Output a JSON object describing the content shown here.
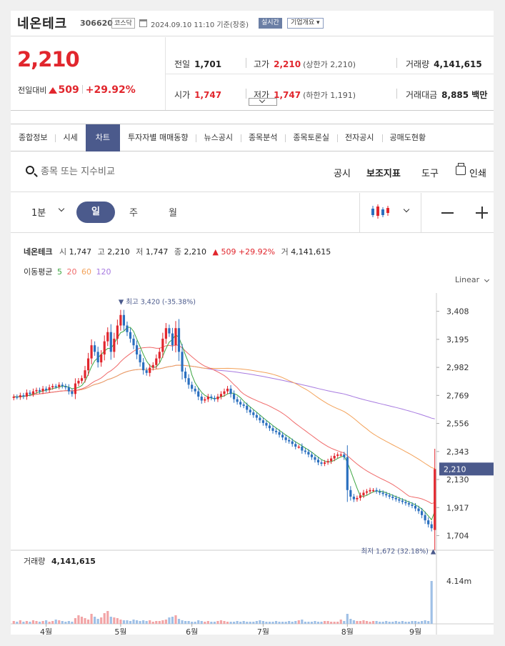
{
  "header": {
    "name": "네온테크",
    "code": "306620",
    "market": "코스닥",
    "datetime": "2024.09.10 11:10 기준(장중)",
    "realtime": "실시간",
    "company_btn": "기업개요 ▾"
  },
  "quote": {
    "price": "2,210",
    "change_label": "전일대비",
    "change": "509",
    "change_pct": "+29.92%",
    "prev_label": "전일",
    "prev": "1,701",
    "high_label": "고가",
    "high": "2,210",
    "high_sub": "(상한가 2,210)",
    "volume_label": "거래량",
    "volume": "4,141,615",
    "open_label": "시가",
    "open": "1,747",
    "low_label": "저가",
    "low": "1,747",
    "low_sub": "(하한가 1,191)",
    "amount_label": "거래대금",
    "amount": "8,885 백만"
  },
  "tabs": [
    "종합정보",
    "시세",
    "차트",
    "투자자별 매매동향",
    "뉴스공시",
    "종목분석",
    "종목토론실",
    "전자공시",
    "공매도현황"
  ],
  "active_tab": "차트",
  "search": {
    "placeholder": "종목 또는 지수비교"
  },
  "tools": {
    "disclosure": "공시",
    "indicator": "보조지표",
    "tool": "도구",
    "print": "인쇄"
  },
  "period": {
    "min": "1분",
    "day": "일",
    "week": "주",
    "month": "월"
  },
  "info": {
    "name": "네온테크",
    "open_k": "시",
    "open": "1,747",
    "high_k": "고",
    "high": "2,210",
    "low_k": "저",
    "low": "1,747",
    "close_k": "종",
    "close": "2,210",
    "change": "▲ 509 +29.92%",
    "vol_k": "거",
    "vol": "4,141,615"
  },
  "ma": {
    "label": "이동평균",
    "p5": "5",
    "p20": "20",
    "p60": "60",
    "p120": "120"
  },
  "colors": {
    "up": "#e1262d",
    "down": "#2a6fbf",
    "ma5": "#3da642",
    "ma20": "#f06a6a",
    "ma60": "#f3a25a",
    "ma120": "#a77ae0",
    "accent": "#4b5a8c"
  },
  "chart_data": {
    "type": "candlestick",
    "scale": "Linear",
    "y_ticks": [
      3408,
      3195,
      2982,
      2769,
      2556,
      2343,
      2130,
      1917,
      1704
    ],
    "y_tick_labels": [
      "3,408",
      "3,195",
      "2,982",
      "2,769",
      "2,556",
      "2,343",
      "2,130",
      "1,917",
      "1,704"
    ],
    "ylim": [
      1620,
      3520
    ],
    "x_labels": [
      "4월",
      "5월",
      "6월",
      "7월",
      "8월",
      "9월"
    ],
    "x_label_index": [
      10,
      33,
      55,
      77,
      103,
      124
    ],
    "current_price": 2210,
    "current_label": "2,210",
    "high_annotation": "▼ 최고 3,420 (-35.38%)",
    "high_index": 33,
    "high_value": 3420,
    "low_annotation": "최저 1,672 (32.18%) ▲",
    "low_index": 129,
    "low_value": 1672,
    "volume_label": "거래량",
    "volume_value": "4,141,615",
    "volume_tick": "4.14m",
    "closes": [
      2760,
      2755,
      2770,
      2760,
      2790,
      2780,
      2800,
      2810,
      2800,
      2820,
      2810,
      2830,
      2840,
      2835,
      2850,
      2840,
      2830,
      2800,
      2780,
      2860,
      2880,
      2900,
      2960,
      3050,
      3150,
      3100,
      3020,
      3080,
      3180,
      3250,
      3100,
      3200,
      3300,
      3380,
      3300,
      3250,
      3200,
      3150,
      3080,
      3020,
      2960,
      2940,
      2980,
      3000,
      3050,
      3100,
      3200,
      3280,
      3240,
      3150,
      3280,
      3100,
      2950,
      2900,
      2850,
      2820,
      2800,
      2760,
      2730,
      2740,
      2760,
      2750,
      2740,
      2760,
      2780,
      2800,
      2820,
      2780,
      2740,
      2720,
      2700,
      2690,
      2660,
      2640,
      2620,
      2600,
      2580,
      2560,
      2540,
      2520,
      2500,
      2490,
      2470,
      2450,
      2430,
      2420,
      2400,
      2380,
      2380,
      2350,
      2340,
      2320,
      2300,
      2280,
      2260,
      2250,
      2260,
      2270,
      2290,
      2310,
      2320,
      2320,
      2300,
      2050,
      2000,
      1980,
      1990,
      2010,
      2030,
      2040,
      2050,
      2050,
      2040,
      2030,
      2020,
      2010,
      2000,
      1990,
      1980,
      1970,
      1960,
      1950,
      1940,
      1930,
      1910,
      1890,
      1860,
      1820,
      1790,
      1760,
      2210
    ],
    "volumes": [
      4,
      3,
      5,
      3,
      4,
      3,
      5,
      4,
      3,
      4,
      5,
      3,
      4,
      6,
      5,
      4,
      3,
      4,
      3,
      8,
      12,
      10,
      8,
      6,
      14,
      10,
      7,
      9,
      15,
      18,
      10,
      9,
      8,
      6,
      5,
      5,
      4,
      6,
      5,
      4,
      5,
      4,
      5,
      3,
      4,
      4,
      5,
      6,
      9,
      10,
      12,
      7,
      5,
      4,
      4,
      3,
      3,
      5,
      4,
      3,
      4,
      3,
      3,
      4,
      5,
      4,
      3,
      3,
      3,
      4,
      3,
      4,
      3,
      3,
      3,
      4,
      5,
      4,
      3,
      3,
      3,
      4,
      3,
      3,
      3,
      4,
      3,
      4,
      5,
      6,
      3,
      3,
      3,
      4,
      3,
      3,
      4,
      4,
      3,
      3,
      3,
      6,
      4,
      14,
      7,
      5,
      4,
      4,
      5,
      4,
      3,
      4,
      4,
      3,
      3,
      4,
      3,
      3,
      4,
      3,
      4,
      3,
      3,
      4,
      4,
      3,
      4,
      5,
      4,
      60
    ]
  }
}
